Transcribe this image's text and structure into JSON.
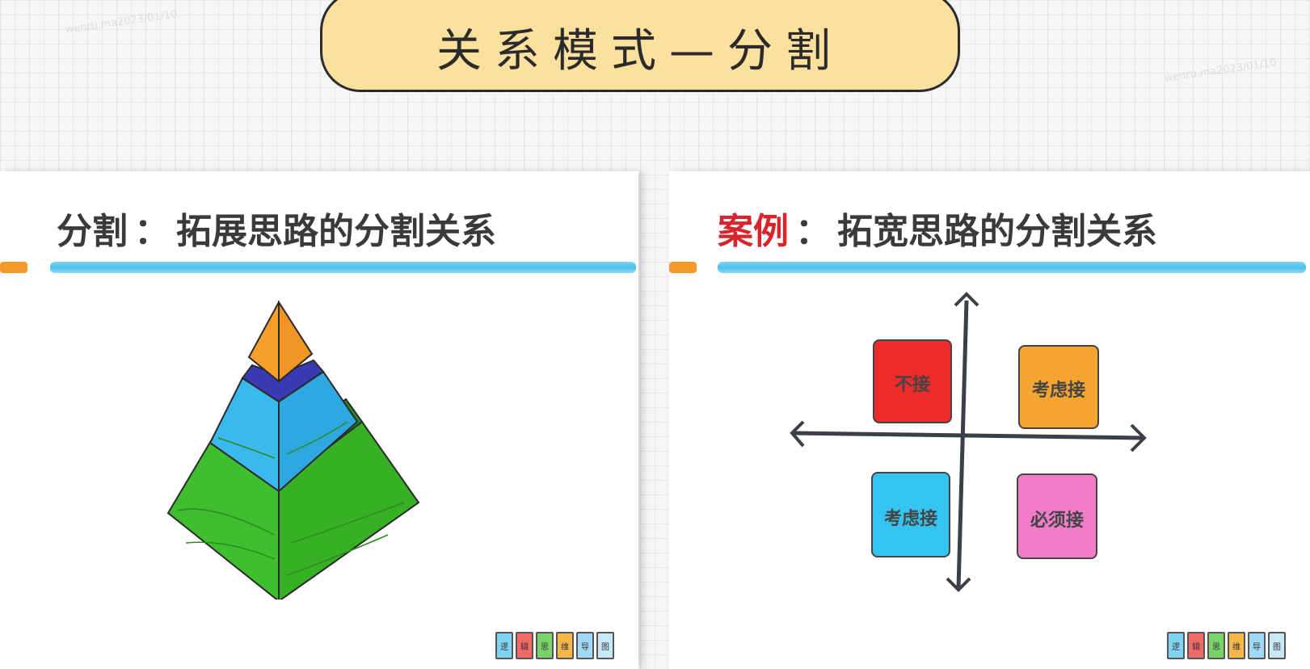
{
  "title": "关系模式—分割",
  "left_panel": {
    "heading_prefix": "分割",
    "heading_sep": "：",
    "heading_rest": "拓展思路的分割关系"
  },
  "right_panel": {
    "heading_prefix": "案例",
    "heading_sep": "：",
    "heading_rest": "拓宽思路的分割关系",
    "quadrants": [
      {
        "label": "不接",
        "color": "#ee2b2b"
      },
      {
        "label": "考虑接",
        "color": "#f5a531"
      },
      {
        "label": "考虑接",
        "color": "#34c4ef"
      },
      {
        "label": "必须接",
        "color": "#f17dc9"
      }
    ]
  },
  "colors": {
    "banner": "#fbe09e",
    "underline": "#4cc0ea",
    "pyramid_top": "#f59e2a",
    "pyramid_top_band": "#3a3ab5",
    "pyramid_middle": "#3bb8ee",
    "pyramid_bottom": "#3fbf2e"
  },
  "watermark_text": "wenru.ma2023/01/10",
  "logo_glyphs": [
    "逻",
    "辑",
    "思",
    "维",
    "导",
    "图"
  ]
}
